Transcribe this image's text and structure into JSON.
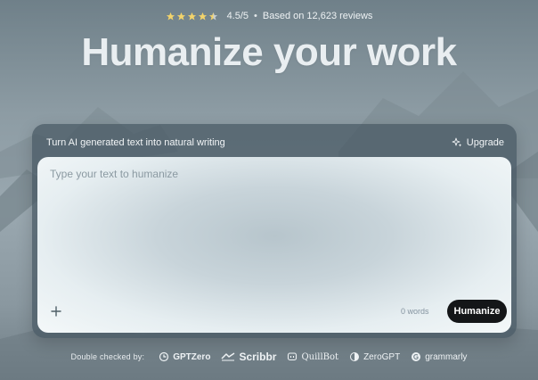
{
  "rating": {
    "stars_full": 4,
    "stars_half": 1,
    "score": "4.5/5",
    "separator": "•",
    "reviews": "Based on 12,623 reviews"
  },
  "headline": "Humanize your work",
  "card": {
    "subtitle": "Turn AI generated text into natural writing",
    "upgrade_label": "Upgrade",
    "editor_placeholder": "Type your text to humanize",
    "editor_value": "",
    "word_count": "0 words",
    "humanize_label": "Humanize"
  },
  "checked_by": {
    "label": "Double checked by:",
    "brands": [
      {
        "name": "GPTZero",
        "icon": "gptzero-icon"
      },
      {
        "name": "Scribbr",
        "icon": "scribbr-icon"
      },
      {
        "name": "QuillBot",
        "icon": "quillbot-icon"
      },
      {
        "name": "ZeroGPT",
        "icon": "zerogpt-icon"
      },
      {
        "name": "grammarly",
        "icon": "grammarly-icon"
      }
    ]
  },
  "colors": {
    "star": "#f2d36b",
    "button_bg": "#141618",
    "card_bg": "#465862"
  }
}
